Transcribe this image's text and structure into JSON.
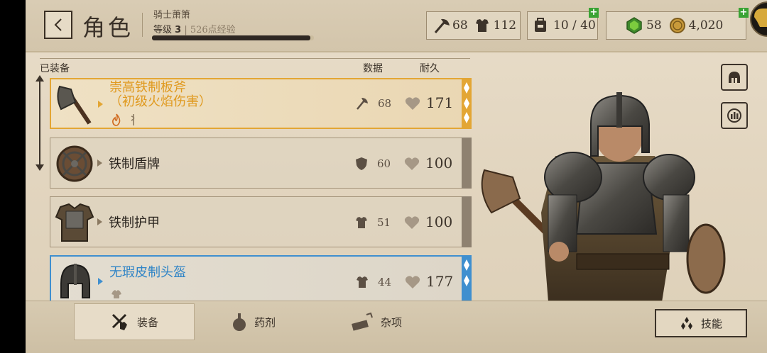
{
  "header": {
    "title": "角色",
    "character_name": "骑士萧箫",
    "level_label": "等级",
    "level_value": "3",
    "xp_text": "526点经验",
    "xp_progress": 0.98
  },
  "stats": {
    "attack": "68",
    "armor": "112",
    "carry": "10 / 40",
    "gems": "58",
    "gold": "4,020"
  },
  "columns": {
    "equipped": "已装备",
    "stats": "数据",
    "durability": "耐久"
  },
  "items": [
    {
      "name_line1": "崇高铁制板斧",
      "name_line2": "（初级火焰伤害）",
      "stat": "68",
      "durability": "171",
      "stat_icon": "axe-icon",
      "rarity": "gold"
    },
    {
      "name_line1": "铁制盾牌",
      "name_line2": "",
      "stat": "60",
      "durability": "100",
      "stat_icon": "shield-icon",
      "rarity": "common"
    },
    {
      "name_line1": "铁制护甲",
      "name_line2": "",
      "stat": "51",
      "durability": "100",
      "stat_icon": "armor-icon",
      "rarity": "common"
    },
    {
      "name_line1": "无瑕皮制头盔",
      "name_line2": "",
      "stat": "44",
      "durability": "177",
      "stat_icon": "armor-icon",
      "rarity": "blue"
    }
  ],
  "tabs": {
    "equipment": "装备",
    "potions": "药剂",
    "misc": "杂项"
  },
  "skills_button": "技能",
  "colors": {
    "gold_rarity": "#e3a634",
    "blue_rarity": "#3f8fcf",
    "plus_green": "#3aa334"
  }
}
